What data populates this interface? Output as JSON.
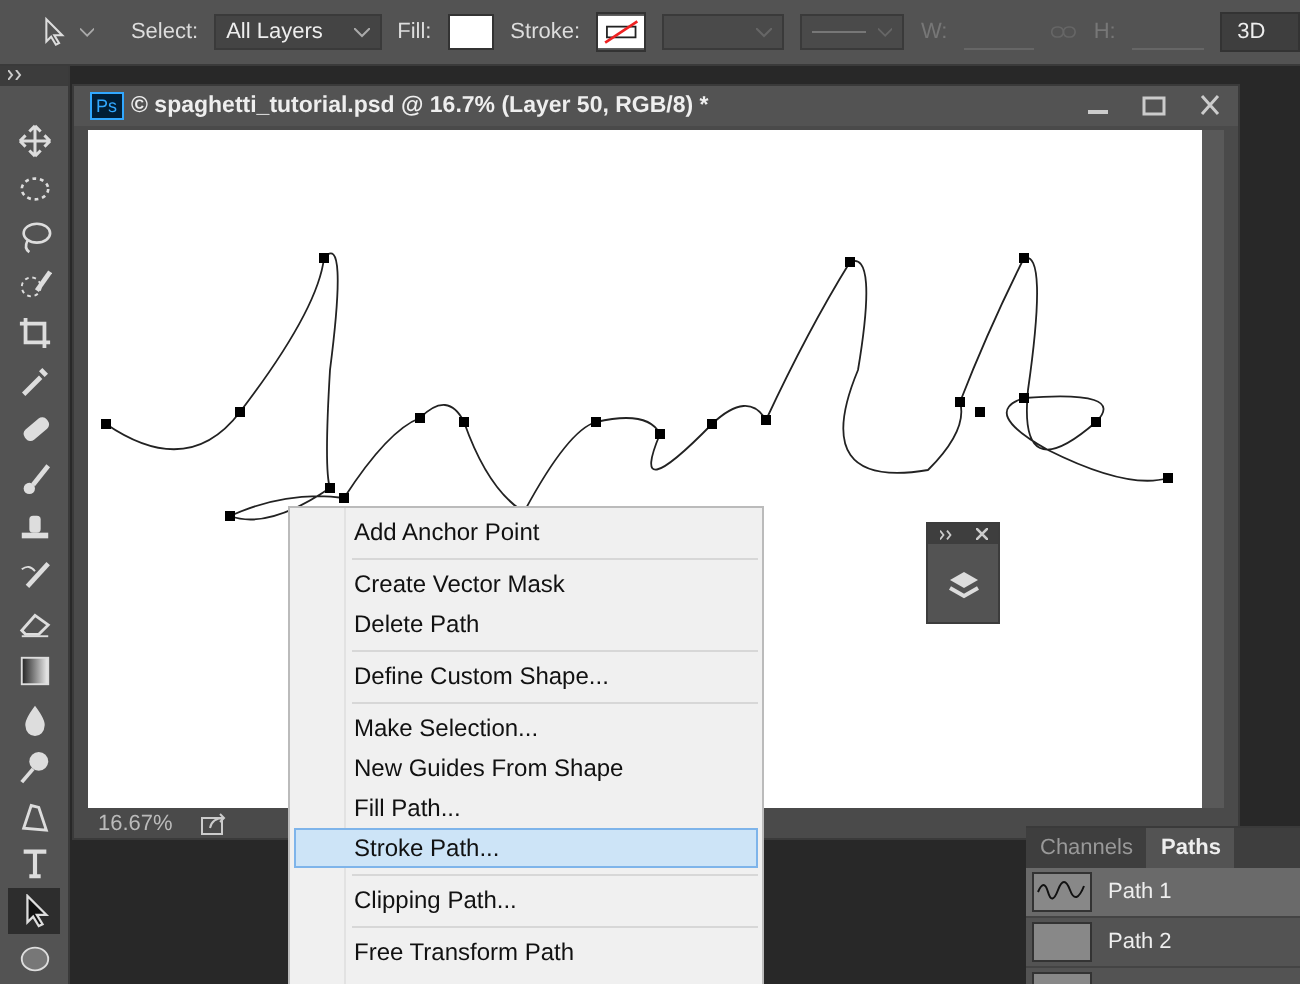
{
  "options_bar": {
    "select_label": "Select:",
    "select_value": "All Layers",
    "fill_label": "Fill:",
    "stroke_label": "Stroke:",
    "w_label": "W:",
    "h_label": "H:",
    "mode": "3D"
  },
  "tools": [
    {
      "kind": "move",
      "selected": false
    },
    {
      "kind": "marquee",
      "selected": false
    },
    {
      "kind": "lasso",
      "selected": false
    },
    {
      "kind": "quick",
      "selected": false
    },
    {
      "kind": "crop",
      "selected": false
    },
    {
      "kind": "eyedropper",
      "selected": false
    },
    {
      "kind": "heal",
      "selected": false
    },
    {
      "kind": "brush",
      "selected": false
    },
    {
      "kind": "stamp",
      "selected": false
    },
    {
      "kind": "history",
      "selected": false
    },
    {
      "kind": "eraser",
      "selected": false
    },
    {
      "kind": "gradient",
      "selected": false
    },
    {
      "kind": "blur",
      "selected": false
    },
    {
      "kind": "dodge",
      "selected": false
    },
    {
      "kind": "pen",
      "selected": false
    },
    {
      "kind": "type",
      "selected": false
    },
    {
      "kind": "select",
      "selected": true
    },
    {
      "kind": "ellipse",
      "selected": false
    }
  ],
  "document": {
    "badge": "Ps",
    "title": "© spaghetti_tutorial.psd @ 16.7% (Layer 50, RGB/8) *",
    "zoom": "16.67%"
  },
  "context_menu": {
    "groups": [
      [
        {
          "label": "Add Anchor Point",
          "selected": false
        }
      ],
      [
        {
          "label": "Create Vector Mask",
          "selected": false
        },
        {
          "label": "Delete Path",
          "selected": false
        }
      ],
      [
        {
          "label": "Define Custom Shape...",
          "selected": false
        }
      ],
      [
        {
          "label": "Make Selection...",
          "selected": false
        },
        {
          "label": "New Guides From Shape",
          "selected": false
        },
        {
          "label": "Fill Path...",
          "selected": false
        },
        {
          "label": "Stroke Path...",
          "selected": true
        }
      ],
      [
        {
          "label": "Clipping Path...",
          "selected": false
        }
      ],
      [
        {
          "label": "Free Transform Path",
          "selected": false
        }
      ]
    ]
  },
  "paths_panel": {
    "tabs": [
      {
        "label": "Channels",
        "selected": false
      },
      {
        "label": "Paths",
        "selected": true
      }
    ],
    "paths": [
      {
        "name": "Path 1",
        "selected": true,
        "preview": true
      },
      {
        "name": "Path 2",
        "selected": false,
        "preview": false
      }
    ]
  }
}
